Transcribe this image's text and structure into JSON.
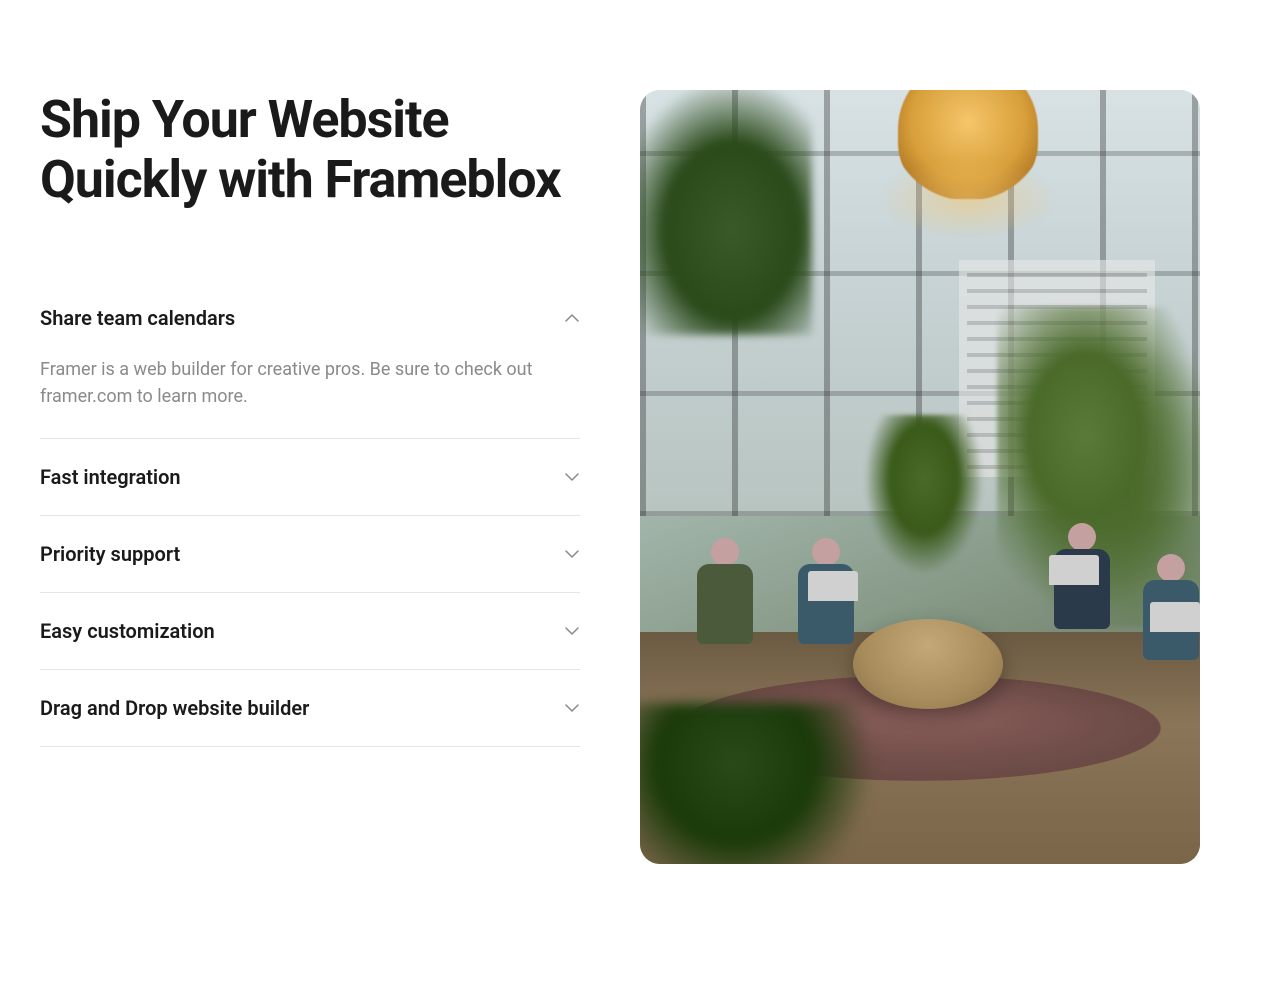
{
  "heading": "Ship Your Website Quickly with Frameblox",
  "accordion": [
    {
      "title": "Share team calendars",
      "body": "Framer is a web builder for creative pros. Be sure to check out framer.com to learn more.",
      "expanded": true
    },
    {
      "title": "Fast integration",
      "expanded": false
    },
    {
      "title": "Priority support",
      "expanded": false
    },
    {
      "title": "Easy customization",
      "expanded": false
    },
    {
      "title": "Drag and Drop website builder",
      "expanded": false
    }
  ],
  "image_alt": "Team working together in a modern office with large windows and plants"
}
